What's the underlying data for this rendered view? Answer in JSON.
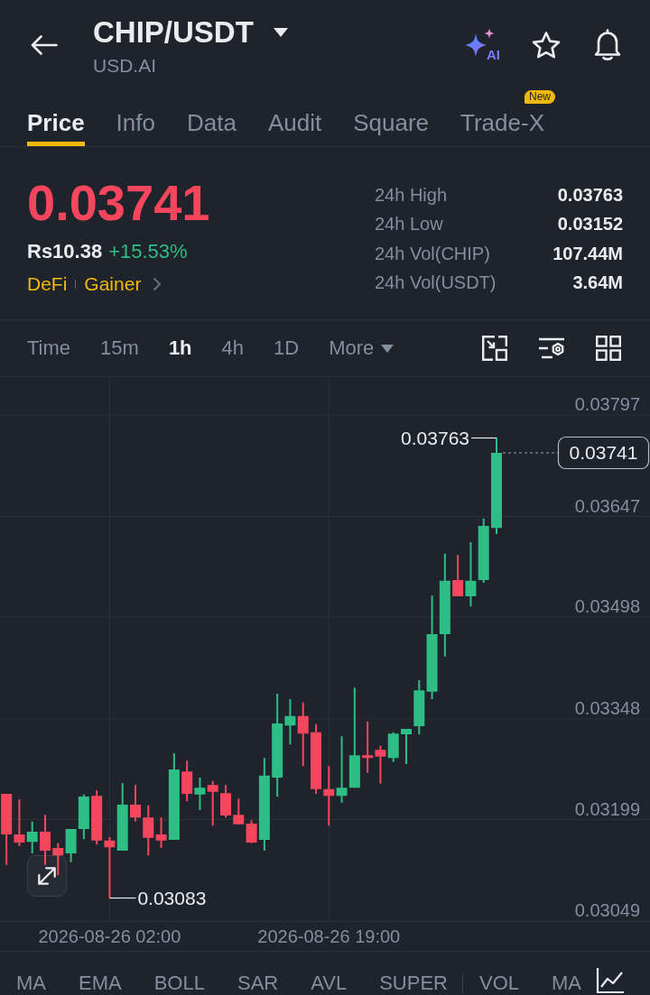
{
  "header": {
    "title": "CHIP/USDT",
    "subtitle": "USD.AI",
    "ai_label": "AI"
  },
  "tabs": [
    {
      "label": "Price",
      "selected": true
    },
    {
      "label": "Info",
      "selected": false
    },
    {
      "label": "Data",
      "selected": false
    },
    {
      "label": "Audit",
      "selected": false
    },
    {
      "label": "Square",
      "selected": false
    },
    {
      "label": "Trade-X",
      "selected": false,
      "badge": "New"
    }
  ],
  "ticker": {
    "price": "0.03741",
    "local_price": "Rs10.38",
    "change": "+15.53%",
    "tags": [
      "DeFi",
      "Gainer"
    ]
  },
  "stats": [
    {
      "label": "24h High",
      "value": "0.03763"
    },
    {
      "label": "24h Low",
      "value": "0.03152"
    },
    {
      "label": "24h Vol(CHIP)",
      "value": "107.44M"
    },
    {
      "label": "24h Vol(USDT)",
      "value": "3.64M"
    }
  ],
  "intervals": [
    {
      "label": "Time",
      "kind": "option",
      "selected": false
    },
    {
      "label": "15m",
      "kind": "option",
      "selected": false
    },
    {
      "label": "1h",
      "kind": "option",
      "selected": true
    },
    {
      "label": "4h",
      "kind": "option",
      "selected": false
    },
    {
      "label": "1D",
      "kind": "option",
      "selected": false
    },
    {
      "label": "More",
      "kind": "dropdown",
      "selected": false
    }
  ],
  "chart": {
    "chart_data": {
      "type": "candlestick",
      "categories": [
        null,
        null,
        null,
        null,
        null,
        null,
        null,
        null,
        "2026-08-26 02:00",
        null,
        null,
        null,
        null,
        null,
        null,
        null,
        null,
        null,
        null,
        null,
        null,
        null,
        null,
        null,
        null,
        "2026-08-26 19:00",
        null,
        null,
        null,
        null,
        null,
        null,
        null,
        null,
        null,
        null,
        null,
        null,
        null
      ],
      "ohlc": [
        [
          0.03237,
          0.03237,
          0.03132,
          0.03177
        ],
        [
          0.03177,
          0.03229,
          0.0316,
          0.03165
        ],
        [
          0.03166,
          0.03196,
          0.03149,
          0.03181
        ],
        [
          0.03181,
          0.03206,
          0.03132,
          0.03153
        ],
        [
          0.03157,
          0.03164,
          0.03117,
          0.03146
        ],
        [
          0.03149,
          0.03185,
          0.03136,
          0.03185
        ],
        [
          0.03185,
          0.03236,
          0.0317,
          0.03233
        ],
        [
          0.03234,
          0.03242,
          0.03162,
          0.03168
        ],
        [
          0.03168,
          0.03173,
          0.03083,
          0.03158
        ],
        [
          0.03153,
          0.03253,
          0.03153,
          0.03221
        ],
        [
          0.03221,
          0.0325,
          0.03196,
          0.03202
        ],
        [
          0.03202,
          0.0322,
          0.03146,
          0.03172
        ],
        [
          0.03177,
          0.03202,
          0.03157,
          0.03168
        ],
        [
          0.03169,
          0.03297,
          0.03169,
          0.03273
        ],
        [
          0.0327,
          0.03286,
          0.03226,
          0.03237
        ],
        [
          0.03236,
          0.03261,
          0.03213,
          0.03246
        ],
        [
          0.0325,
          0.03256,
          0.0319,
          0.0324
        ],
        [
          0.03238,
          0.0325,
          0.03202,
          0.03205
        ],
        [
          0.03206,
          0.0323,
          0.03192,
          0.03192
        ],
        [
          0.03193,
          0.03198,
          0.03164,
          0.03165
        ],
        [
          0.03169,
          0.0329,
          0.03153,
          0.03264
        ],
        [
          0.03261,
          0.03385,
          0.03233,
          0.03341
        ],
        [
          0.03338,
          0.03377,
          0.0331,
          0.03352
        ],
        [
          0.03352,
          0.03372,
          0.03278,
          0.03326
        ],
        [
          0.03328,
          0.0334,
          0.03237,
          0.03244
        ],
        [
          0.03244,
          0.03278,
          0.0319,
          0.03234
        ],
        [
          0.03234,
          0.03322,
          0.03224,
          0.03246
        ],
        [
          0.03246,
          0.03394,
          0.03246,
          0.03294
        ],
        [
          0.03294,
          0.03344,
          0.03268,
          0.0329
        ],
        [
          0.03302,
          0.03308,
          0.03252,
          0.03292
        ],
        [
          0.0329,
          0.03328,
          0.03284,
          0.03326
        ],
        [
          0.03325,
          0.03333,
          0.03281,
          0.03333
        ],
        [
          0.03337,
          0.03405,
          0.03325,
          0.0339
        ],
        [
          0.03388,
          0.0353,
          0.03377,
          0.03473
        ],
        [
          0.03473,
          0.03592,
          0.0344,
          0.03552
        ],
        [
          0.03553,
          0.0359,
          0.03529,
          0.03529
        ],
        [
          0.03529,
          0.03609,
          0.03514,
          0.03552
        ],
        [
          0.03553,
          0.03644,
          0.03549,
          0.03633
        ],
        [
          0.0363,
          0.03763,
          0.03621,
          0.03741
        ]
      ],
      "ylim": [
        0.03049,
        0.03853
      ],
      "yticks": [
        0.03797,
        0.03647,
        0.03498,
        0.03348,
        0.03199,
        0.03049
      ],
      "grid": true,
      "annotations": [
        "0.03763",
        "0.03083"
      ],
      "ref_lines": [
        {
          "axis": "y",
          "value": 0.03741,
          "label": "0.03741"
        }
      ]
    }
  },
  "indicators": {
    "main": [
      "MA",
      "EMA",
      "BOLL",
      "SAR",
      "AVL",
      "SUPER"
    ],
    "sub": [
      "VOL",
      "MA"
    ]
  }
}
